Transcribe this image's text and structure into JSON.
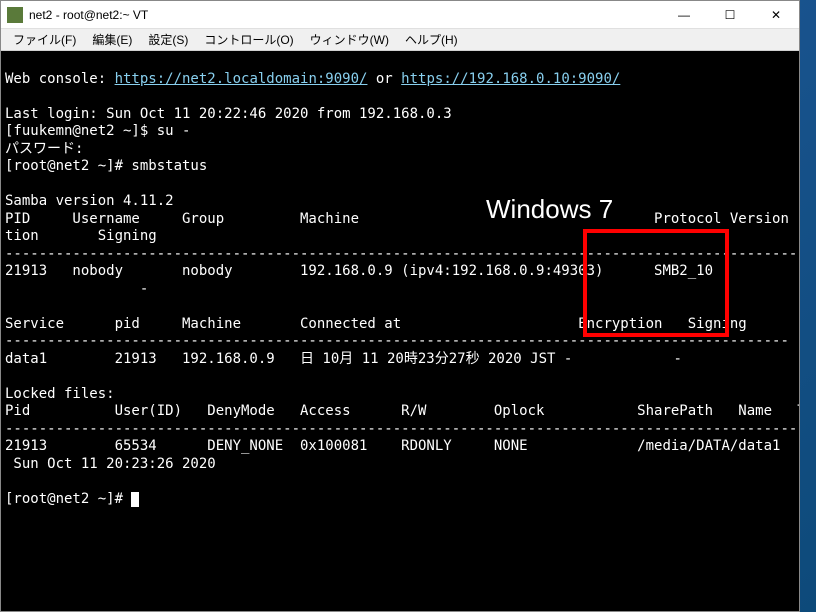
{
  "window": {
    "title": "net2 - root@net2:~ VT",
    "buttons": {
      "min": "—",
      "max": "☐",
      "close": "✕"
    }
  },
  "menu": {
    "file": "ファイル(F)",
    "edit": "編集(E)",
    "settings": "設定(S)",
    "control": "コントロール(O)",
    "windowm": "ウィンドウ(W)",
    "help": "ヘルプ(H)"
  },
  "overlay": {
    "label": "Windows 7"
  },
  "term": {
    "line1a": "Web console: ",
    "link1": "https://net2.localdomain:9090/",
    "line1b": " or ",
    "link2": "https://192.168.0.10:9090/",
    "blank": "",
    "lastlogin": "Last login: Sun Oct 11 20:22:46 2020 from 192.168.0.3",
    "su": "[fuukemn@net2 ~]$ su -",
    "password": "パスワード:",
    "smbstatus": "[root@net2 ~]# smbstatus",
    "samba_ver": "Samba version 4.11.2",
    "hdr1": "PID     Username     Group         Machine                                   Protocol Version  Encryp",
    "hdr1b": "tion       Signing",
    "dash1": "----------------------------------------------------------------------------------------------------",
    "row1": "21913   nobody       nobody        192.168.0.9 (ipv4:192.168.0.9:49303)      SMB2_10           -",
    "row1b": "                -",
    "svc_hdr": "Service      pid     Machine       Connected at                     Encryption   Signing",
    "dash2": "---------------------------------------------------------------------------------------------",
    "svc_row": "data1        21913   192.168.0.9   日 10月 11 20時23分27秒 2020 JST -            -",
    "locked": "Locked files:",
    "lock_hdr": "Pid          User(ID)   DenyMode   Access      R/W        Oplock           SharePath   Name   Time",
    "dash3": "--------------------------------------------------------------------------------------------------",
    "lock_row": "21913        65534      DENY_NONE  0x100081    RDONLY     NONE             /media/DATA/data1   .",
    "lock_row2": " Sun Oct 11 20:23:26 2020",
    "prompt": "[root@net2 ~]# "
  },
  "chart_data": null
}
